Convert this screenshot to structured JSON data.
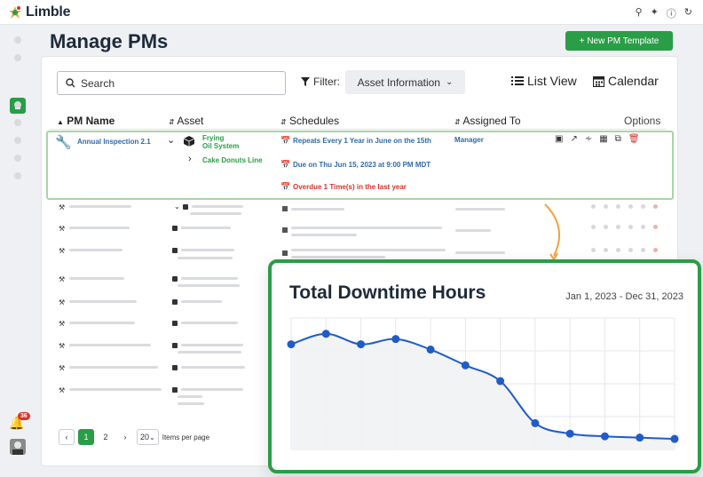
{
  "app": {
    "name": "Limble"
  },
  "page": {
    "title": "Manage PMs",
    "new_button": "+ New PM Template"
  },
  "toolbar": {
    "search_placeholder": "Search",
    "filter_label": "Filter:",
    "filter_value": "Asset Information",
    "list_view": "List View",
    "calendar_view": "Calendar"
  },
  "table": {
    "headers": {
      "pm_name": "PM Name",
      "asset": "Asset",
      "schedules": "Schedules",
      "assigned_to": "Assigned To",
      "options": "Options"
    },
    "expanded_row": {
      "pm_name": "Annual Inspection 2.1",
      "asset_line1": "Frying",
      "asset_line2": "Oil System",
      "child_asset": "Cake Donuts Line",
      "schedule1": "Repeats Every 1 Year in June on the 15th",
      "schedule2": "Due on Thu Jun 15, 2023 at 9:00 PM MDT",
      "schedule3": "Overdue 1 Time(s) in the last year",
      "assigned_to": "Manager"
    }
  },
  "pagination": {
    "prev": "‹",
    "page1": "1",
    "page2": "2",
    "next": "›",
    "per_page_value": "20",
    "per_page_label": "Items per page"
  },
  "notifications": {
    "count": "36"
  },
  "chart_card": {
    "title": "Total Downtime Hours",
    "range": "Jan 1, 2023 - Dec 31, 2023"
  },
  "chart_data": {
    "type": "line",
    "title": "Total Downtime Hours",
    "subtitle": "Jan 1, 2023 - Dec 31, 2023",
    "series": [
      {
        "values": [
          10,
          14,
          10,
          12,
          8,
          2,
          -4,
          -20,
          -24,
          -25,
          -25.5,
          -26
        ]
      }
    ],
    "ylim": [
      -30,
      20
    ],
    "grid": true,
    "colors": {
      "line": "#1f5cc7",
      "fill": "#f1f2f4"
    }
  },
  "colors": {
    "accent": "#2a9d47",
    "danger": "#d9322b",
    "link": "#2f6aa8"
  }
}
